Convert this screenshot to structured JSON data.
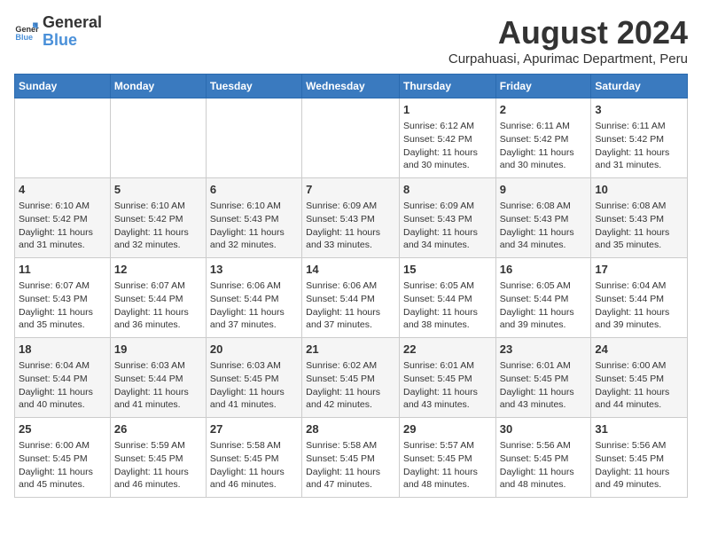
{
  "header": {
    "logo_general": "General",
    "logo_blue": "Blue",
    "month_year": "August 2024",
    "location": "Curpahuasi, Apurimac Department, Peru"
  },
  "days_of_week": [
    "Sunday",
    "Monday",
    "Tuesday",
    "Wednesday",
    "Thursday",
    "Friday",
    "Saturday"
  ],
  "weeks": [
    [
      {
        "day": "",
        "content": ""
      },
      {
        "day": "",
        "content": ""
      },
      {
        "day": "",
        "content": ""
      },
      {
        "day": "",
        "content": ""
      },
      {
        "day": "1",
        "content": "Sunrise: 6:12 AM\nSunset: 5:42 PM\nDaylight: 11 hours\nand 30 minutes."
      },
      {
        "day": "2",
        "content": "Sunrise: 6:11 AM\nSunset: 5:42 PM\nDaylight: 11 hours\nand 30 minutes."
      },
      {
        "day": "3",
        "content": "Sunrise: 6:11 AM\nSunset: 5:42 PM\nDaylight: 11 hours\nand 31 minutes."
      }
    ],
    [
      {
        "day": "4",
        "content": "Sunrise: 6:10 AM\nSunset: 5:42 PM\nDaylight: 11 hours\nand 31 minutes."
      },
      {
        "day": "5",
        "content": "Sunrise: 6:10 AM\nSunset: 5:42 PM\nDaylight: 11 hours\nand 32 minutes."
      },
      {
        "day": "6",
        "content": "Sunrise: 6:10 AM\nSunset: 5:43 PM\nDaylight: 11 hours\nand 32 minutes."
      },
      {
        "day": "7",
        "content": "Sunrise: 6:09 AM\nSunset: 5:43 PM\nDaylight: 11 hours\nand 33 minutes."
      },
      {
        "day": "8",
        "content": "Sunrise: 6:09 AM\nSunset: 5:43 PM\nDaylight: 11 hours\nand 34 minutes."
      },
      {
        "day": "9",
        "content": "Sunrise: 6:08 AM\nSunset: 5:43 PM\nDaylight: 11 hours\nand 34 minutes."
      },
      {
        "day": "10",
        "content": "Sunrise: 6:08 AM\nSunset: 5:43 PM\nDaylight: 11 hours\nand 35 minutes."
      }
    ],
    [
      {
        "day": "11",
        "content": "Sunrise: 6:07 AM\nSunset: 5:43 PM\nDaylight: 11 hours\nand 35 minutes."
      },
      {
        "day": "12",
        "content": "Sunrise: 6:07 AM\nSunset: 5:44 PM\nDaylight: 11 hours\nand 36 minutes."
      },
      {
        "day": "13",
        "content": "Sunrise: 6:06 AM\nSunset: 5:44 PM\nDaylight: 11 hours\nand 37 minutes."
      },
      {
        "day": "14",
        "content": "Sunrise: 6:06 AM\nSunset: 5:44 PM\nDaylight: 11 hours\nand 37 minutes."
      },
      {
        "day": "15",
        "content": "Sunrise: 6:05 AM\nSunset: 5:44 PM\nDaylight: 11 hours\nand 38 minutes."
      },
      {
        "day": "16",
        "content": "Sunrise: 6:05 AM\nSunset: 5:44 PM\nDaylight: 11 hours\nand 39 minutes."
      },
      {
        "day": "17",
        "content": "Sunrise: 6:04 AM\nSunset: 5:44 PM\nDaylight: 11 hours\nand 39 minutes."
      }
    ],
    [
      {
        "day": "18",
        "content": "Sunrise: 6:04 AM\nSunset: 5:44 PM\nDaylight: 11 hours\nand 40 minutes."
      },
      {
        "day": "19",
        "content": "Sunrise: 6:03 AM\nSunset: 5:44 PM\nDaylight: 11 hours\nand 41 minutes."
      },
      {
        "day": "20",
        "content": "Sunrise: 6:03 AM\nSunset: 5:45 PM\nDaylight: 11 hours\nand 41 minutes."
      },
      {
        "day": "21",
        "content": "Sunrise: 6:02 AM\nSunset: 5:45 PM\nDaylight: 11 hours\nand 42 minutes."
      },
      {
        "day": "22",
        "content": "Sunrise: 6:01 AM\nSunset: 5:45 PM\nDaylight: 11 hours\nand 43 minutes."
      },
      {
        "day": "23",
        "content": "Sunrise: 6:01 AM\nSunset: 5:45 PM\nDaylight: 11 hours\nand 43 minutes."
      },
      {
        "day": "24",
        "content": "Sunrise: 6:00 AM\nSunset: 5:45 PM\nDaylight: 11 hours\nand 44 minutes."
      }
    ],
    [
      {
        "day": "25",
        "content": "Sunrise: 6:00 AM\nSunset: 5:45 PM\nDaylight: 11 hours\nand 45 minutes."
      },
      {
        "day": "26",
        "content": "Sunrise: 5:59 AM\nSunset: 5:45 PM\nDaylight: 11 hours\nand 46 minutes."
      },
      {
        "day": "27",
        "content": "Sunrise: 5:58 AM\nSunset: 5:45 PM\nDaylight: 11 hours\nand 46 minutes."
      },
      {
        "day": "28",
        "content": "Sunrise: 5:58 AM\nSunset: 5:45 PM\nDaylight: 11 hours\nand 47 minutes."
      },
      {
        "day": "29",
        "content": "Sunrise: 5:57 AM\nSunset: 5:45 PM\nDaylight: 11 hours\nand 48 minutes."
      },
      {
        "day": "30",
        "content": "Sunrise: 5:56 AM\nSunset: 5:45 PM\nDaylight: 11 hours\nand 48 minutes."
      },
      {
        "day": "31",
        "content": "Sunrise: 5:56 AM\nSunset: 5:45 PM\nDaylight: 11 hours\nand 49 minutes."
      }
    ]
  ]
}
